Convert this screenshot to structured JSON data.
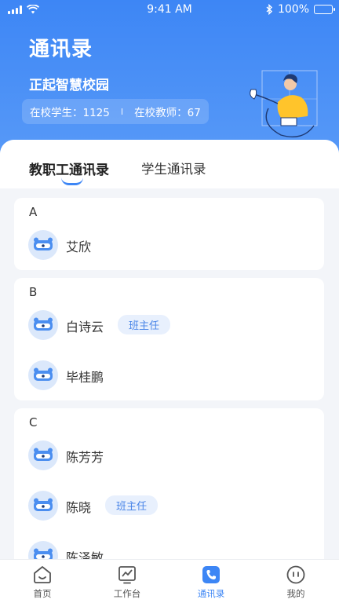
{
  "status_bar": {
    "time": "9:41 AM",
    "battery": "100%"
  },
  "header": {
    "title": "通讯录",
    "school_name": "正起智慧校园",
    "student_count_label": "在校学生：1125",
    "separator": "I",
    "teacher_count_label": "在校教师：67"
  },
  "tabs": [
    {
      "label": "教职工通讯录",
      "active": true
    },
    {
      "label": "学生通讯录",
      "active": false
    }
  ],
  "groups": [
    {
      "letter": "A",
      "contacts": [
        {
          "name": "艾欣",
          "badge": ""
        }
      ]
    },
    {
      "letter": "B",
      "contacts": [
        {
          "name": "白诗云",
          "badge": "班主任"
        },
        {
          "name": "毕桂鹏",
          "badge": ""
        }
      ]
    },
    {
      "letter": "C",
      "contacts": [
        {
          "name": "陈芳芳",
          "badge": ""
        },
        {
          "name": "陈晓",
          "badge": "班主任"
        },
        {
          "name": "陈泽敏",
          "badge": ""
        }
      ]
    }
  ],
  "tabbar": [
    {
      "label": "首页",
      "icon": "home-face-icon",
      "active": false
    },
    {
      "label": "工作台",
      "icon": "chart-board-icon",
      "active": false
    },
    {
      "label": "通讯录",
      "icon": "phone-icon",
      "active": true
    },
    {
      "label": "我的",
      "icon": "profile-face-icon",
      "active": false
    }
  ],
  "colors": {
    "primary": "#3d86f5",
    "badge_bg": "#e8f0fd",
    "background": "#f3f5f9"
  }
}
